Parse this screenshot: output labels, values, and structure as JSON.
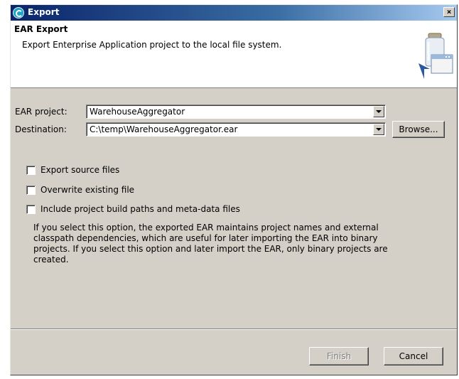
{
  "window": {
    "title": "Export",
    "close_glyph": "×"
  },
  "header": {
    "title": "EAR Export",
    "description": "Export Enterprise Application project to the local file system.",
    "graphic": "jar-window-wizard-icon"
  },
  "form": {
    "ear_project": {
      "label": "EAR project:",
      "value": "WarehouseAggregator"
    },
    "destination": {
      "label": "Destination:",
      "value": "C:\\temp\\WarehouseAggregator.ear"
    },
    "browse_label": "Browse..."
  },
  "options": [
    {
      "label": "Export source files",
      "checked": false
    },
    {
      "label": "Overwrite existing file",
      "checked": false
    },
    {
      "label": "Include project build paths and meta-data files",
      "checked": false
    }
  ],
  "info": {
    "text": "If you select this option, the exported EAR maintains project names and external classpath dependencies, which are useful for later importing the EAR into binary projects. If you select this option and later import the EAR, only binary projects are created."
  },
  "buttons": {
    "finish": "Finish",
    "cancel": "Cancel"
  },
  "colors": {
    "title_gradient_start": "#0a246a",
    "title_gradient_end": "#a6caf0",
    "dialog_bg": "#d4d0c8"
  }
}
